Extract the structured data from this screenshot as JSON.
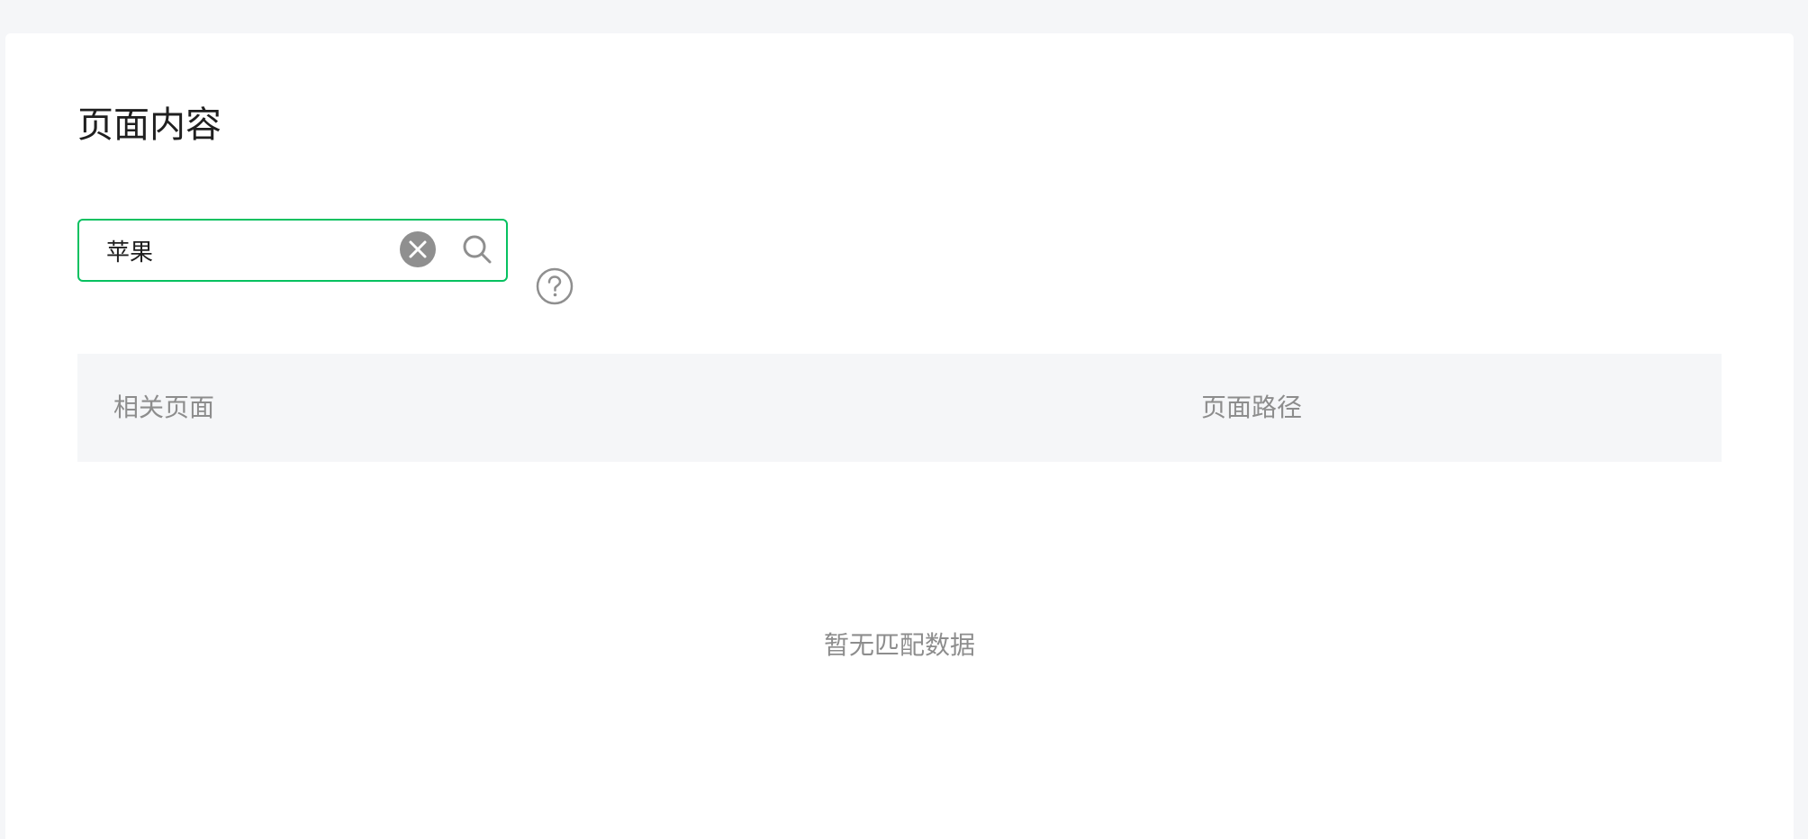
{
  "page": {
    "title": "页面内容"
  },
  "search": {
    "value": "苹果",
    "placeholder": "",
    "clear_icon": "close-circle-icon",
    "search_icon": "search-icon",
    "help_icon": "help-circle-icon",
    "accent_color": "#07c160"
  },
  "table": {
    "columns": [
      {
        "label": "相关页面"
      },
      {
        "label": "页面路径"
      }
    ],
    "rows": [],
    "empty_text": "暂无匹配数据"
  }
}
